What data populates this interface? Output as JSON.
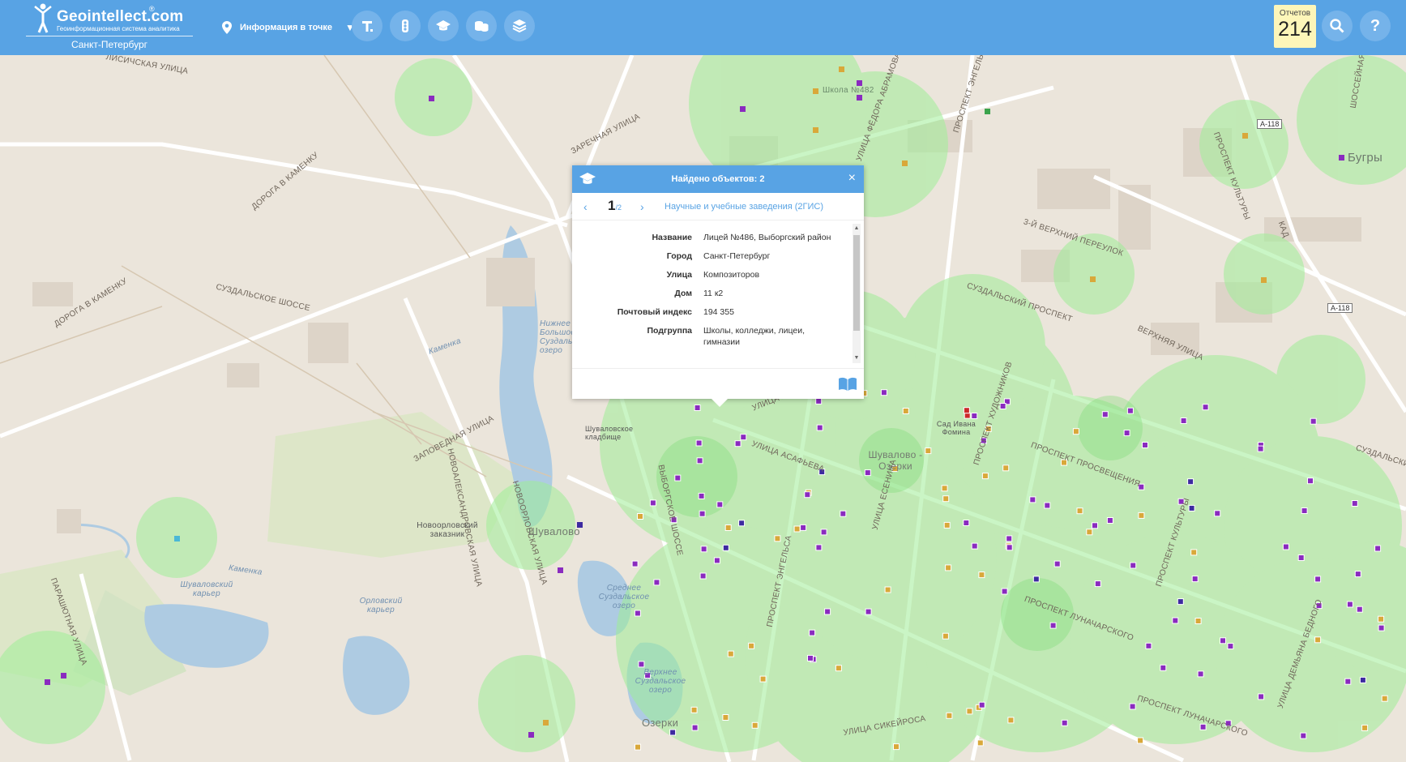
{
  "header": {
    "logo_text": "Geointellect",
    "logo_domain": ".com",
    "logo_reg": "®",
    "logo_subtitle": "Геоинформационная система аналитика",
    "city": "Санкт-Петербург",
    "mode_label": "Информация в точке",
    "tools": [
      "text-tool-icon",
      "traffic-light-icon",
      "graduation-cap-icon",
      "coins-icon",
      "layers-icon"
    ],
    "reports_label": "Отчетов",
    "reports_count": "214",
    "accent_color": "#58a3e4"
  },
  "popup": {
    "title": "Найдено объектов: 2",
    "close": "×",
    "prev": "‹",
    "next": "›",
    "page": "1",
    "total": "/2",
    "layer": "Научные и учебные заведения (2ГИС)",
    "scroll_up": "▲",
    "scroll_down": "▼",
    "rows": [
      {
        "key": "Название",
        "value": "Лицей №486, Выборгский район"
      },
      {
        "key": "Город",
        "value": "Санкт-Петербург"
      },
      {
        "key": "Улица",
        "value": "Композиторов"
      },
      {
        "key": "Дом",
        "value": "11 к2"
      },
      {
        "key": "Почтовый индекс",
        "value": "194 355"
      },
      {
        "key": "Подгруппа",
        "value": "Школы, колледжи, лицеи, гимназии"
      }
    ]
  },
  "map": {
    "streets": [
      "Лисичская улица",
      "Заречная улица",
      "Дорога в Каменку",
      "Суздальское шоссе",
      "Дорога в Каменку",
      "Заповедная улица",
      "Новоалександровская улица",
      "Новоорловская улица",
      "Парашютная улица",
      "Выборгское шоссе",
      "Улица Хошимина",
      "Улица Асафьева",
      "Проспект Художников",
      "Проспект Просвещения",
      "Улица Есенина",
      "Проспект Энгельса",
      "Проспект Луначарского",
      "Улица Сикейроса",
      "Суздальский проспект",
      "3-й Верхний переулок",
      "Верхняя улица",
      "Проспект Культуры",
      "Улица Демьяна Бедного",
      "Улица Фёдора Абрамова",
      "Проспект Энгельса",
      "Проспект Луначарского",
      "Суздальский проспект",
      "КАД",
      "Шоссейная улица",
      "Проспект Культуры",
      "Школа №482"
    ],
    "water": [
      "Каменка",
      "Каменка",
      "Шуваловский карьер",
      "Орловский карьер",
      "Среднее Суздальское озеро",
      "Верхнее Суздальское озеро",
      "Нижнее Большое Суздальское озеро",
      "Шуваловское кладбище",
      "Сад Ивана Фомина"
    ],
    "places": [
      "Новоорловский заказник",
      "Шувалово",
      "Озерки",
      "Бугры",
      "Шувалово - Озерки"
    ],
    "shields": [
      "А-118",
      "А-118"
    ],
    "point_colors": [
      "#8a2bbf",
      "#d9a83a",
      "#3d2aa0",
      "#cc2a2a"
    ]
  }
}
